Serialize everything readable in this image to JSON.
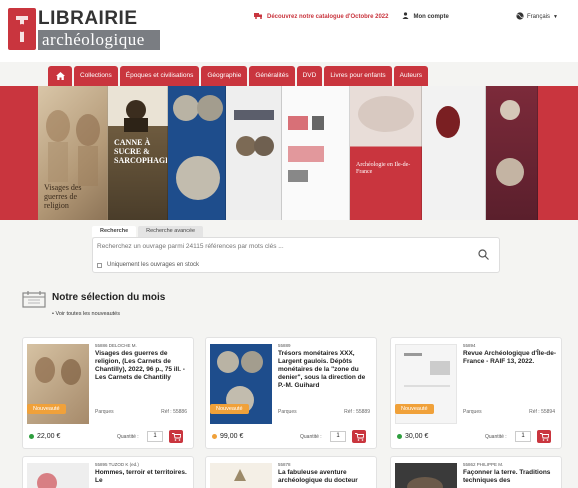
{
  "header": {
    "logo_top": "LIBRAIRIE",
    "logo_bottom": "archéologique",
    "promo": "Découvrez notre catalogue d'Octobre 2022",
    "account": "Mon compte",
    "language": "Français"
  },
  "nav": {
    "items": [
      "Collections",
      "Époques et civilisations",
      "Géographie",
      "Généralités",
      "DVD",
      "Livres pour enfants",
      "Auteurs"
    ]
  },
  "banner": {
    "captions": [
      "Visages des guerres de religion",
      "CANNE À SUCRE & SARCOPHAGES",
      "",
      "",
      "",
      "Archéologie en Ile-de-France",
      "",
      ""
    ]
  },
  "search": {
    "tabs": [
      "Recherche",
      "Recherche avancée"
    ],
    "placeholder": "Recherchez un ouvrage parmi 24115 références par mots clés ...",
    "checkbox_label": "Uniquement les ouvrages en stock"
  },
  "selection": {
    "title": "Notre sélection du mois",
    "link": "• Voir toutes les nouveautés"
  },
  "products": [
    {
      "ref": "55886 DELOCHE M.",
      "title": "Visages des guerres de religion, (Les Carnets de Chantilly), 2022, 96 p., 75 ill. - Les Carnets de Chantilly",
      "publisher": "Parques",
      "refno": "Réf : 55886",
      "badge": "Nouveauté",
      "price": "22,00 €",
      "qty_label": "Quantité :",
      "qty": "1",
      "status_color": "#2e9e3e"
    },
    {
      "ref": "55889",
      "title": "Trésors monétaires XXX, Largent gaulois. Dépôts monétaires de la \"zone du denier\", sous la direction de P.-M. Guihard",
      "publisher": "Parques",
      "refno": "Réf : 55889",
      "badge": "Nouveauté",
      "price": "99,00 €",
      "qty_label": "Quantité :",
      "qty": "1",
      "status_color": "#f0a13a"
    },
    {
      "ref": "55894",
      "title": "Revue Archéologique d'Île-de-France - RAIF 13, 2022.",
      "publisher": "Parques",
      "refno": "Réf : 55894",
      "badge": "Nouveauté",
      "price": "30,00 €",
      "qty_label": "Quantité :",
      "qty": "1",
      "status_color": "#2e9e3e"
    }
  ],
  "products_row2": [
    {
      "ref": "55895 TUZOD K (ed.)",
      "title": "Hommes, terroir et territoires. Le"
    },
    {
      "ref": "55878",
      "title": "La fabuleuse aventure archéologique du docteur"
    },
    {
      "ref": "55862 PHILIPPE M.",
      "title": "Façonner la terre. Traditions techniques des"
    }
  ]
}
